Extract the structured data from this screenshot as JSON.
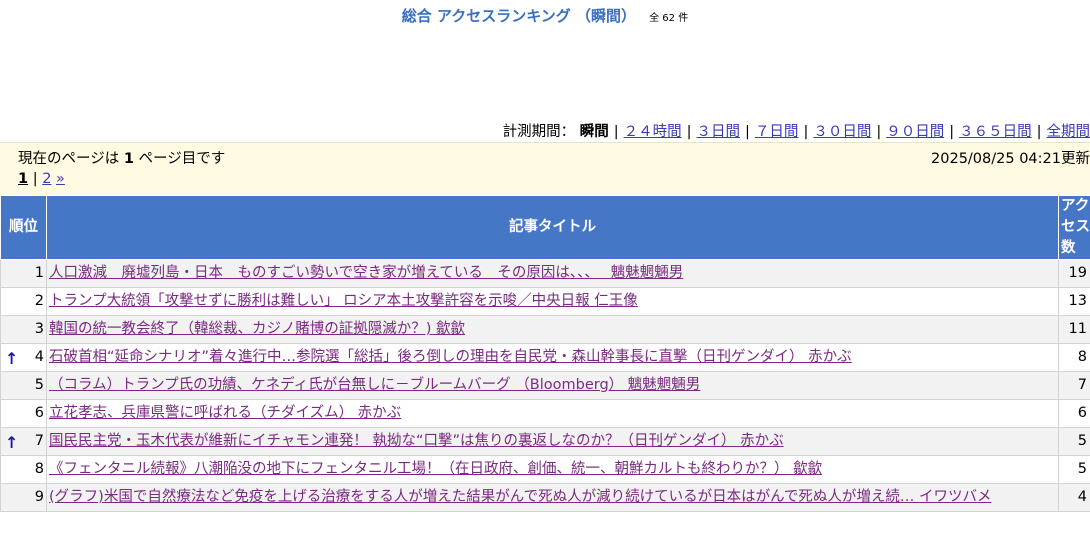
{
  "header": {
    "title": "総合 アクセスランキング （瞬間）",
    "count": "全 62 件"
  },
  "period": {
    "label": "計測期間：",
    "current": "瞬間",
    "links": [
      "２４時間",
      "３日間",
      "７日間",
      "３０日間",
      "９０日間",
      "３６５日間",
      "全期間"
    ]
  },
  "info": {
    "page_prefix": "現在のページは ",
    "page_number": "1",
    "page_suffix": " ページ目です",
    "updated": "2025/08/25 04:21更新"
  },
  "pager": {
    "current": "1",
    "next_page": "2",
    "next_arrow": "»"
  },
  "table": {
    "headers": {
      "rank": "順位",
      "title": "記事タイトル",
      "access": "アクセス数"
    },
    "rows": [
      {
        "rank": "1",
        "title": "人口激減　廃墟列島・日本　ものすごい勢いで空き家が増えている　その原因は、、、　 魑魅魍魎男",
        "access": "19",
        "trend": ""
      },
      {
        "rank": "2",
        "title": "トランプ大統領「攻撃せずに勝利は難しい」 ロシア本土攻撃許容を示唆／中央日報 仁王像",
        "access": "13",
        "trend": ""
      },
      {
        "rank": "3",
        "title": "韓国の統一教会終了（韓総裁、カジノ賭博の証拠隠滅か？) 歙歙",
        "access": "11",
        "trend": ""
      },
      {
        "rank": "4",
        "title": "石破首相“延命シナリオ”着々進行中…参院選「総括」後ろ倒しの理由を自民党・森山幹事長に直撃（日刊ゲンダイ） 赤かぶ",
        "access": "8",
        "trend": "up"
      },
      {
        "rank": "5",
        "title": "（コラム）トランプ氏の功績、ケネディ氏が台無しに－ブルームバーグ （Bloomberg） 魑魅魍魎男",
        "access": "7",
        "trend": ""
      },
      {
        "rank": "6",
        "title": "立花孝志、兵庫県警に呼ばれる（チダイズム） 赤かぶ",
        "access": "6",
        "trend": ""
      },
      {
        "rank": "7",
        "title": "国民民主党・玉木代表が維新にイチャモン連発！ 執拗な“口撃”は焦りの裏返しなのか？（日刊ゲンダイ） 赤かぶ",
        "access": "5",
        "trend": "up"
      },
      {
        "rank": "8",
        "title": "《フェンタニル続報》八潮陥没の地下にフェンタニル工場！（在日政府、創価、統一、朝鮮カルトも終わりか？） 歙歙",
        "access": "5",
        "trend": ""
      },
      {
        "rank": "9",
        "title": "(グラフ)米国で自然療法など免疫を上げる治療をする人が増えた結果がんで死ぬ人が減り続けているが日本はがんで死ぬ人が増え続… イワツバメ",
        "access": "4",
        "trend": ""
      }
    ]
  },
  "icons": {
    "trend_up": "↑"
  },
  "colors": {
    "title": "#3a6fbf",
    "table_header": "#4677c6",
    "link": "#3a3ab8",
    "visited_link": "#7a2a80",
    "info_bg": "#fffbe3"
  }
}
